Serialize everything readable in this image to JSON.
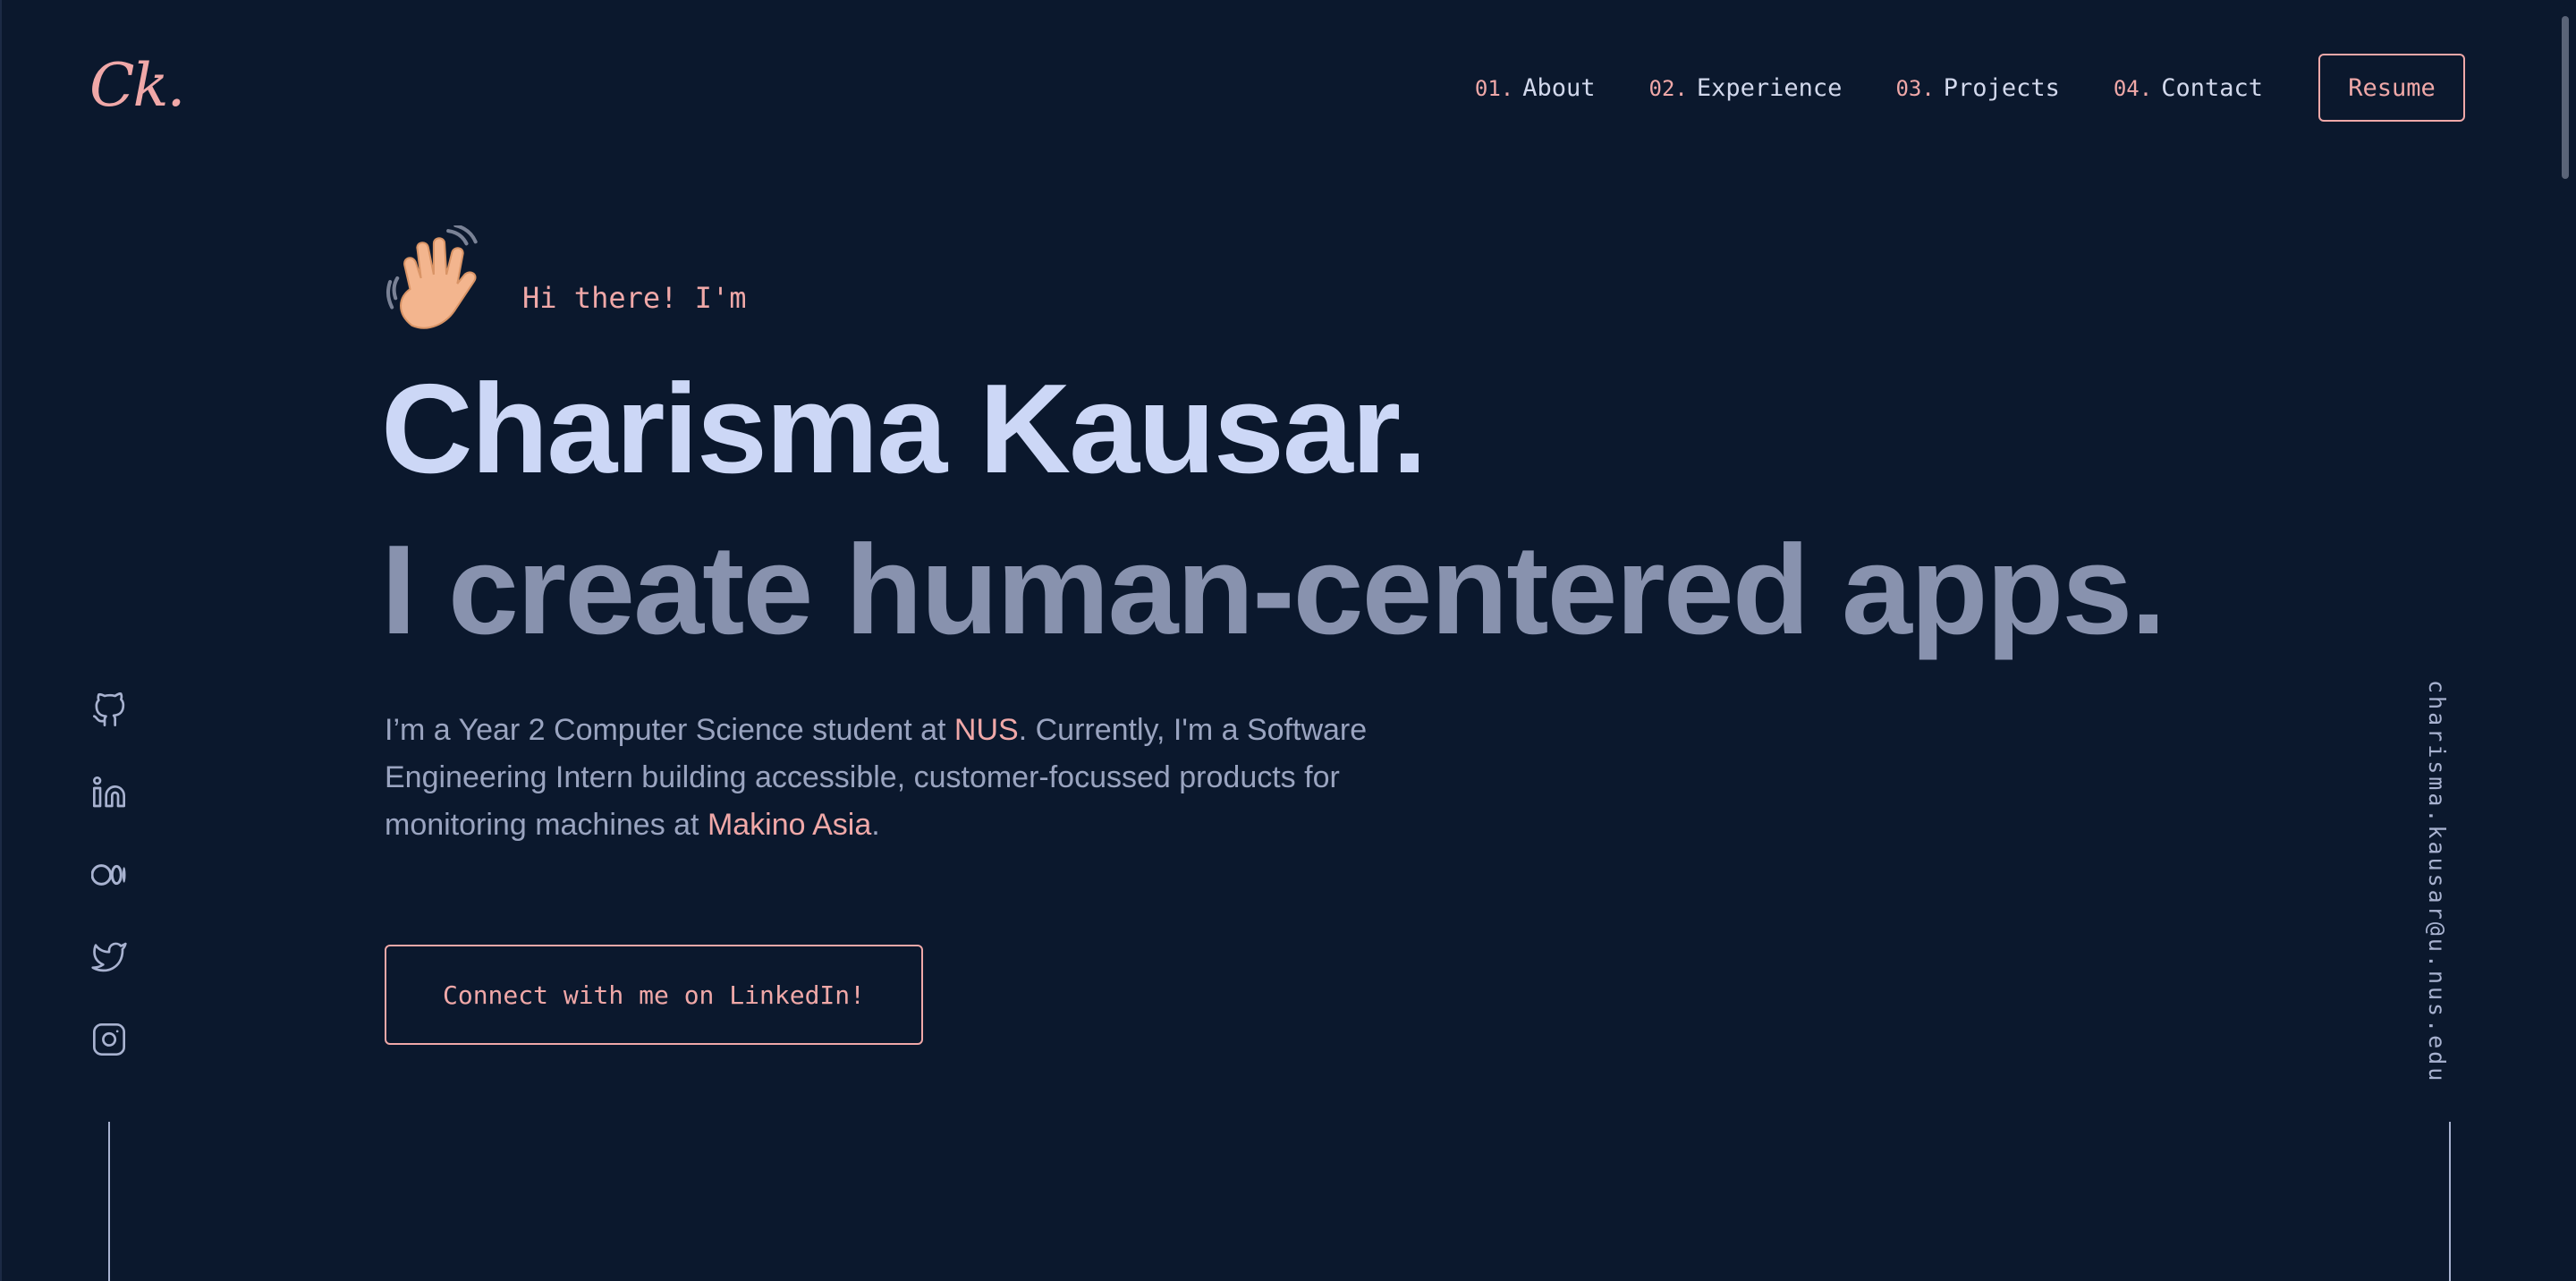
{
  "logo": {
    "text": "Ck."
  },
  "nav": {
    "items": [
      {
        "num": "01.",
        "label": "About"
      },
      {
        "num": "02.",
        "label": "Experience"
      },
      {
        "num": "03.",
        "label": "Projects"
      },
      {
        "num": "04.",
        "label": "Contact"
      }
    ],
    "resume_label": "Resume"
  },
  "hero": {
    "greeting": "Hi there! I'm",
    "name": "Charisma Kausar.",
    "tagline": "I create human-centered apps.",
    "bio": {
      "part1": "I’m a Year 2 Computer Science student at ",
      "highlight1": "NUS",
      "part2": ". Currently, I'm a Software Engineering Intern building accessible, customer-focussed products for monitoring machines at ",
      "highlight2": "Makino Asia",
      "part3": "."
    },
    "cta_label": "Connect with me on LinkedIn!"
  },
  "social": {
    "icons": [
      "github-icon",
      "linkedin-icon",
      "medium-icon",
      "twitter-icon",
      "instagram-icon"
    ]
  },
  "email": "charisma.kausar@u.nus.edu",
  "colors": {
    "background": "#0b182d",
    "accent": "#f0a8a8",
    "heading": "#ccd7f6",
    "subheading": "#8892ae",
    "body": "#9aa4c0"
  }
}
